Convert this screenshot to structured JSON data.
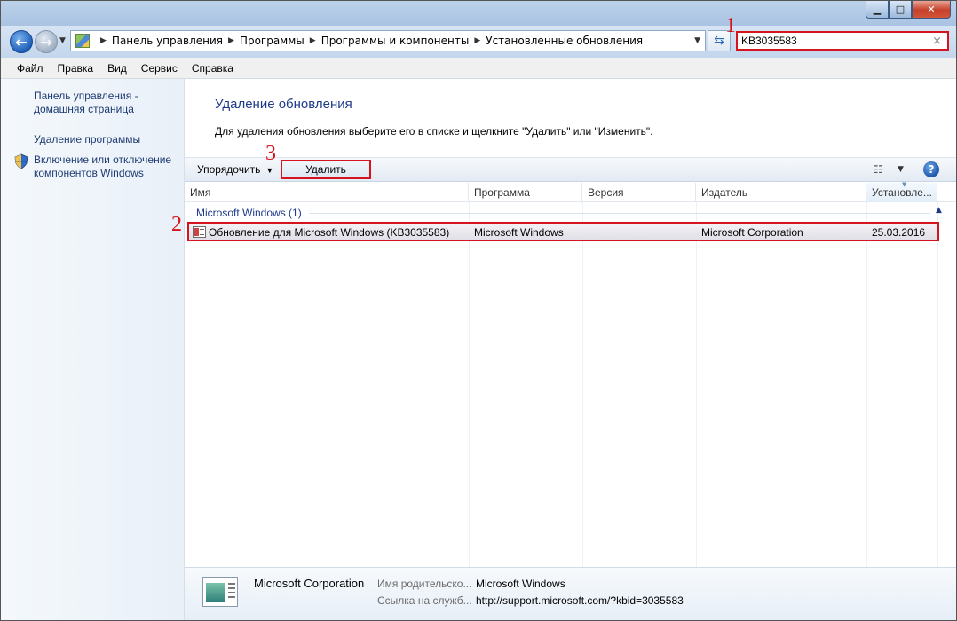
{
  "colors": {
    "highlight": "#d6141e",
    "link": "#1e3b72",
    "title": "#1e3a8a"
  },
  "address": {
    "breadcrumbs": [
      "Панель управления",
      "Программы",
      "Программы и компоненты",
      "Установленные обновления"
    ]
  },
  "search": {
    "value": "KB3035583",
    "clear_icon": "×"
  },
  "markers": {
    "one": "1",
    "two": "2",
    "three": "3"
  },
  "menu": [
    "Файл",
    "Правка",
    "Вид",
    "Сервис",
    "Справка"
  ],
  "sidebar": {
    "home_link": [
      "Панель управления -",
      "домашняя страница"
    ],
    "uninstall_link": "Удаление программы",
    "features_link": [
      "Включение или отключение",
      "компонентов Windows"
    ]
  },
  "main": {
    "title": "Удаление обновления",
    "description": "Для удаления обновления выберите его в списке и щелкните \"Удалить\" или \"Изменить\"."
  },
  "toolbar": {
    "organize": "Упорядочить",
    "delete": "Удалить",
    "help": "?"
  },
  "columns": [
    "Имя",
    "Программа",
    "Версия",
    "Издатель",
    "Установле..."
  ],
  "group": {
    "label": "Microsoft Windows (1)"
  },
  "rows": [
    {
      "name": "Обновление для Microsoft Windows (KB3035583)",
      "program": "Microsoft Windows",
      "version": "",
      "publisher": "Microsoft Corporation",
      "installed": "25.03.2016"
    }
  ],
  "details": {
    "publisher": "Microsoft Corporation",
    "parent_label": "Имя родительско...",
    "parent_value": "Microsoft Windows",
    "support_label": "Ссылка на служб...",
    "support_value": "http://support.microsoft.com/?kbid=3035583"
  }
}
